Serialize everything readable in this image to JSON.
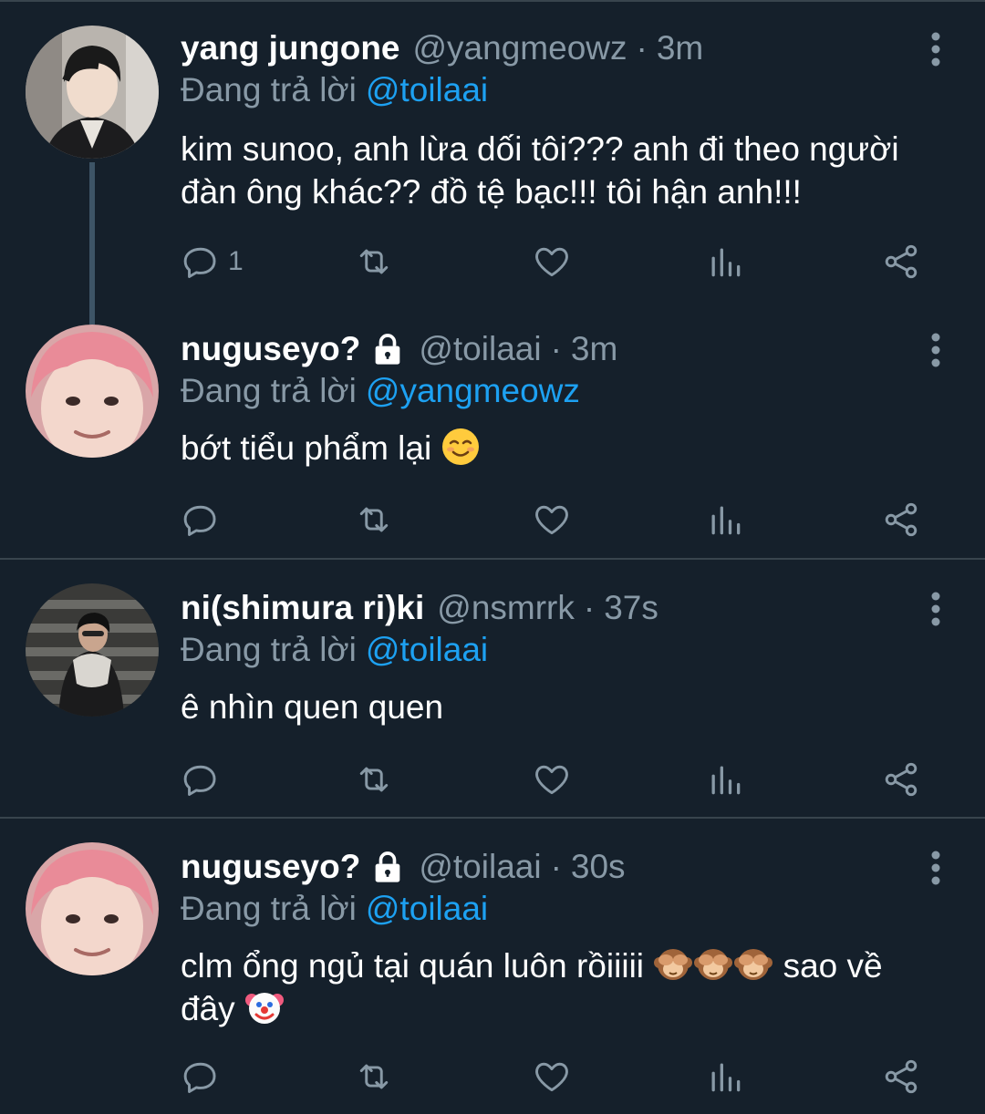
{
  "reply_prefix": "Đang trả lời",
  "tweets": [
    {
      "display_name": "yang jungone",
      "handle": "@yangmeowz",
      "time": "3m",
      "reply_to": "@toilaai",
      "text_lines": [
        "kim sunoo, anh lừa dối tôi??? anh đi theo người",
        "đàn ông khác?? đồ tệ bạc!!! tôi hận anh!!!"
      ],
      "reply_count": "1",
      "protected": false
    },
    {
      "display_name": "nuguseyo?",
      "handle": "@toilaai",
      "time": "3m",
      "reply_to": "@yangmeowz",
      "text_before_emoji": "bớt tiểu phẩm lại",
      "emoji": "smiling-face-icon",
      "protected": true
    },
    {
      "display_name": "ni(shimura ri)ki",
      "handle": "@nsmrrk",
      "time": "37s",
      "reply_to": "@toilaai",
      "text": "ê nhìn quen quen",
      "protected": false
    },
    {
      "display_name": "nuguseyo?",
      "handle": "@toilaai",
      "time": "30s",
      "reply_to": "@toilaai",
      "text_part1": "clm ổng ngủ tại quán luôn rồiiiii",
      "text_part2": "sao về",
      "text_part3": "đây",
      "emojis": [
        "see-no-evil-monkey-icon",
        "see-no-evil-monkey-icon",
        "see-no-evil-monkey-icon",
        "clown-face-icon"
      ],
      "protected": true
    }
  ],
  "colors": {
    "background": "#15202b",
    "secondary_text": "#8899a6",
    "link": "#1da1f2",
    "divider": "#38444d"
  }
}
